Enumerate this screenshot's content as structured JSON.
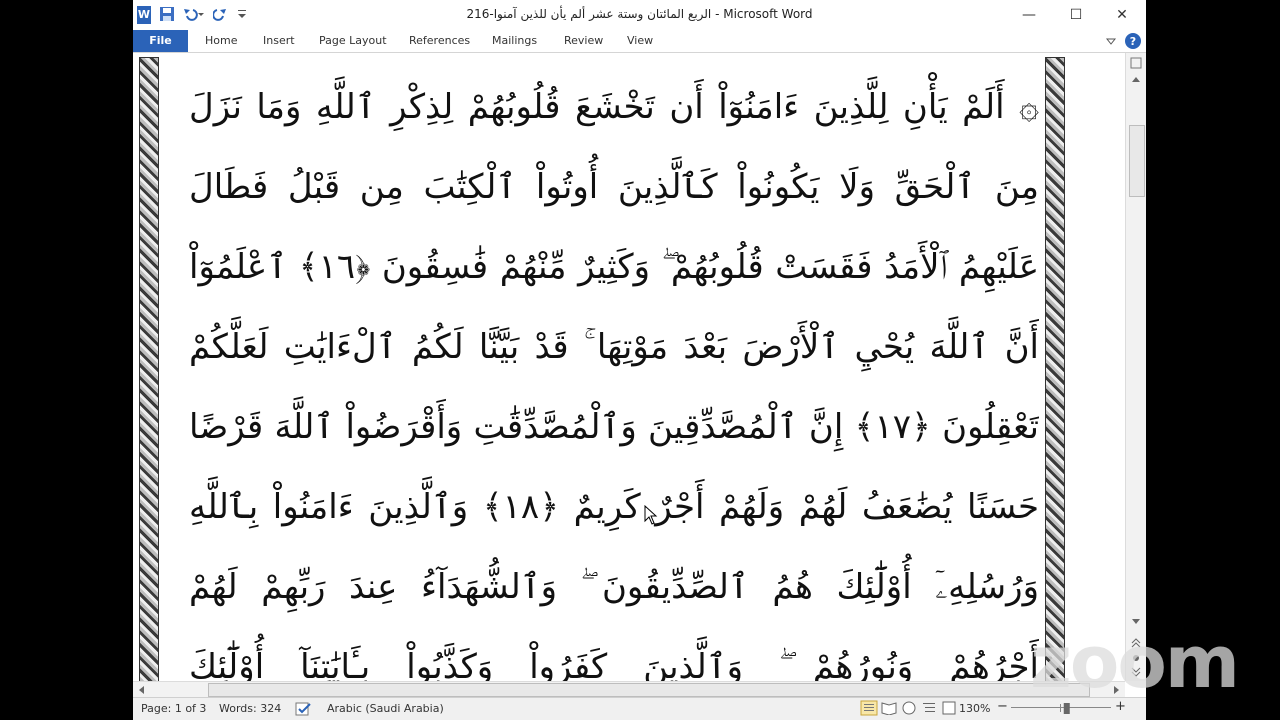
{
  "window": {
    "title": "الربع المائتان وستة عشر ألم يأن للذين آمنوا-216  -  Microsoft Word",
    "controls": {
      "minimize": "—",
      "maximize": "☐",
      "close": "✕"
    }
  },
  "quick_access": {
    "app_icon": "W",
    "save_icon": "save-icon",
    "undo_icon": "undo-icon",
    "redo_icon": "redo-icon"
  },
  "ribbon": {
    "file_label": "File",
    "tabs": [
      "Home",
      "Insert",
      "Page Layout",
      "References",
      "Mailings",
      "Review",
      "View"
    ]
  },
  "document": {
    "lines": [
      "۞ أَلَمْ يَأْنِ لِلَّذِينَ ءَامَنُوٓاْ أَن تَخْشَعَ قُلُوبُهُمْ لِذِكْرِ ٱللَّهِ وَمَا نَزَلَ",
      "مِنَ ٱلْحَقِّ وَلَا يَكُونُواْ كَٱلَّذِينَ أُوتُواْ ٱلْكِتَٰبَ مِن قَبْلُ فَطَالَ",
      "عَلَيْهِمُ ٱلْأَمَدُ فَقَسَتْ قُلُوبُهُمْ ۖ وَكَثِيرٌ مِّنْهُمْ فَٰسِقُونَ ﴿١٦﴾ ٱعْلَمُوٓاْ",
      "أَنَّ ٱللَّهَ يُحْيِ ٱلْأَرْضَ بَعْدَ مَوْتِهَا ۚ قَدْ بَيَّنَّا لَكُمُ ٱلْءَايَٰتِ لَعَلَّكُمْ",
      "تَعْقِلُونَ ﴿١٧﴾ إِنَّ ٱلْمُصَّدِّقِينَ وَٱلْمُصَّدِّقَٰتِ وَأَقْرَضُواْ ٱللَّهَ قَرْضًا",
      "حَسَنًا يُضَٰعَفُ لَهُمْ وَلَهُمْ أَجْرٌ كَرِيمٌ ﴿١٨﴾ وَٱلَّذِينَ ءَامَنُواْ بِٱللَّهِ",
      "وَرُسُلِهِۦٓ أُوْلَٰٓئِكَ هُمُ ٱلصِّدِّيقُونَ ۖ وَٱلشُّهَدَآءُ عِندَ رَبِّهِمْ لَهُمْ",
      "أَجْرُهُمْ وَنُورُهُمْ ۖ وَٱلَّذِينَ كَفَرُواْ وَكَذَّبُواْ بِـَٔايَٰتِنَآ أُوْلَٰٓئِكَ"
    ],
    "text_color": "#111111",
    "tajweed_red": "#e11b1b"
  },
  "status_bar": {
    "page": "Page: 1 of 3",
    "words": "Words: 324",
    "language": "Arabic (Saudi Arabia)",
    "zoom": "130%",
    "zoom_level": 130,
    "zoom_out": "−",
    "zoom_in": "+"
  },
  "overlay": {
    "watermark": "zoom"
  }
}
